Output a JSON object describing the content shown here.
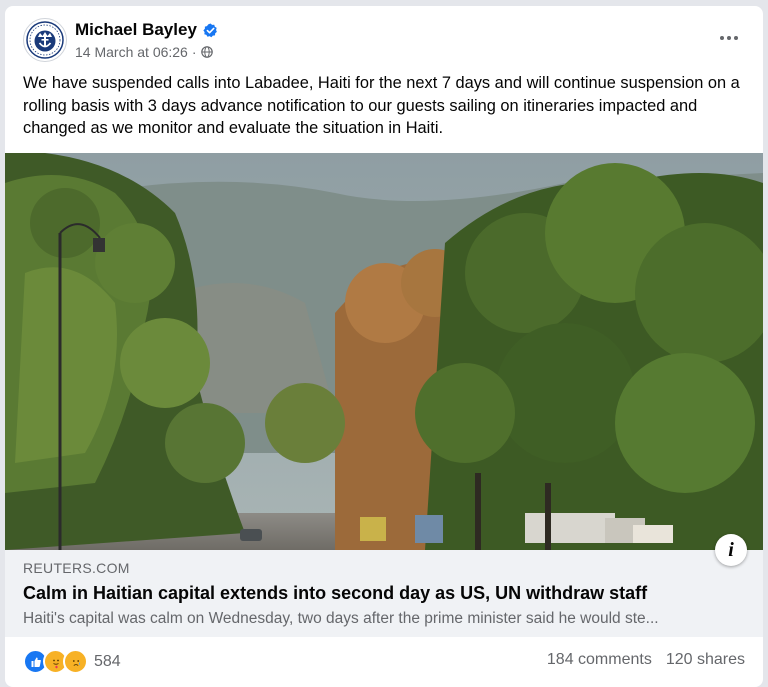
{
  "post": {
    "author": "Michael Bayley",
    "timestamp": "14 March at 06:26",
    "separator": "·",
    "text": "We have suspended calls into Labadee, Haiti for the next 7 days and will continue suspension on a rolling basis with 3 days advance notification to our guests sailing on itineraries impacted and changed as we monitor and evaluate the situation in Haiti."
  },
  "link": {
    "domain": "REUTERS.COM",
    "headline": "Calm in Haitian capital extends into second day as US, UN withdraw staff",
    "description": "Haiti's capital was calm on Wednesday, two days after the prime minister said he would ste..."
  },
  "footer": {
    "reaction_count": "584",
    "comments": "184 comments",
    "shares": "120 shares"
  },
  "icons": {
    "avatar": "royal-caribbean-crown-anchor-logo",
    "verified": "verified-badge-icon",
    "privacy": "globe-icon",
    "more": "more-options-icon",
    "info": "info-icon",
    "reactions": [
      "like-icon",
      "care-icon",
      "sad-icon"
    ]
  },
  "colors": {
    "verified": "#1877f2",
    "like": "#1877f2",
    "care": "#f7b125",
    "sad": "#f7b125",
    "secondary_text": "#65676b",
    "preview_bg": "#f0f2f5"
  }
}
